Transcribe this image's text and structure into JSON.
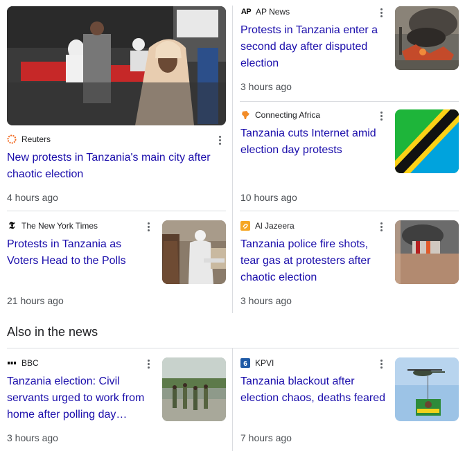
{
  "section_title": "Also in the news",
  "stories": [
    {
      "source": "Reuters",
      "headline": "New protests in Tanzania's main city after chaotic election",
      "time": "4 hours ago"
    },
    {
      "source": "AP News",
      "headline": "Protests in Tanzania enter a second day after disputed election",
      "time": "3 hours ago"
    },
    {
      "source": "Connecting Africa",
      "headline": "Tanzania cuts Internet amid election day protests",
      "time": "10 hours ago"
    },
    {
      "source": "The New York Times",
      "headline": "Protests in Tanzania as Voters Head to the Polls",
      "time": "21 hours ago"
    },
    {
      "source": "Al Jazeera",
      "headline": "Tanzania police fire shots, tear gas at protesters after chaotic election",
      "time": "3 hours ago"
    },
    {
      "source": "BBC",
      "headline": "Tanzania election: Civil servants urged to work from home after polling day…",
      "time": "3 hours ago"
    },
    {
      "source": "KPVI",
      "headline": "Tanzania blackout after election chaos, deaths feared",
      "time": "7 hours ago"
    }
  ],
  "logos": {
    "ap": "AP"
  },
  "colors": {
    "link": "#1a0dab",
    "divider": "#dadce0",
    "meta": "#4d5156"
  },
  "icons": [
    "reuters-logo-icon",
    "ap-logo-icon",
    "africa-map-icon",
    "nyt-logo-icon",
    "aljazeera-logo-icon",
    "bbc-logo-icon",
    "kpvi-logo-icon",
    "more-options-icon"
  ]
}
